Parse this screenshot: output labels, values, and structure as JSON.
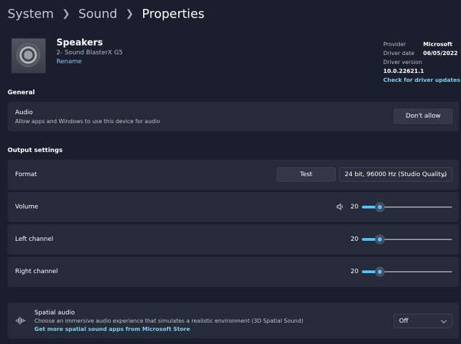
{
  "breadcrumb": {
    "items": [
      "System",
      "Sound",
      "Properties"
    ]
  },
  "device": {
    "name": "Speakers",
    "subtitle": "2- Sound BlasterX G5",
    "rename_label": "Rename"
  },
  "driver": {
    "provider_label": "Provider",
    "provider_value": "Microsoft",
    "date_label": "Driver date",
    "date_value": "06/05/2022",
    "version_label": "Driver version",
    "version_value": "10.0.22621.1",
    "update_link": "Check for driver updates"
  },
  "general": {
    "heading": "General",
    "audio_title": "Audio",
    "audio_desc": "Allow apps and Windows to use this device for audio",
    "dont_allow_label": "Don't allow"
  },
  "output": {
    "heading": "Output settings",
    "format_label": "Format",
    "test_label": "Test",
    "format_value": "24 bit, 96000 Hz (Studio Quality)",
    "volume_label": "Volume",
    "volume_value": "20",
    "left_label": "Left channel",
    "left_value": "20",
    "right_label": "Right channel",
    "right_value": "20",
    "slider_max": 100
  },
  "spatial": {
    "title": "Spatial audio",
    "desc": "Choose an immersive audio experience that simulates a realistic environment (3D Spatial Sound)",
    "link": "Get more spatial sound apps from Microsoft Store",
    "value": "Off"
  },
  "colors": {
    "accent": "#4cc2ff",
    "link": "#7fcdf2",
    "background": "#1b1f2d",
    "card": "#262b3a"
  },
  "icons": [
    "chevron-right-icon",
    "speaker-device-icon",
    "chevron-down-icon",
    "volume-icon",
    "spatial-audio-icon"
  ]
}
